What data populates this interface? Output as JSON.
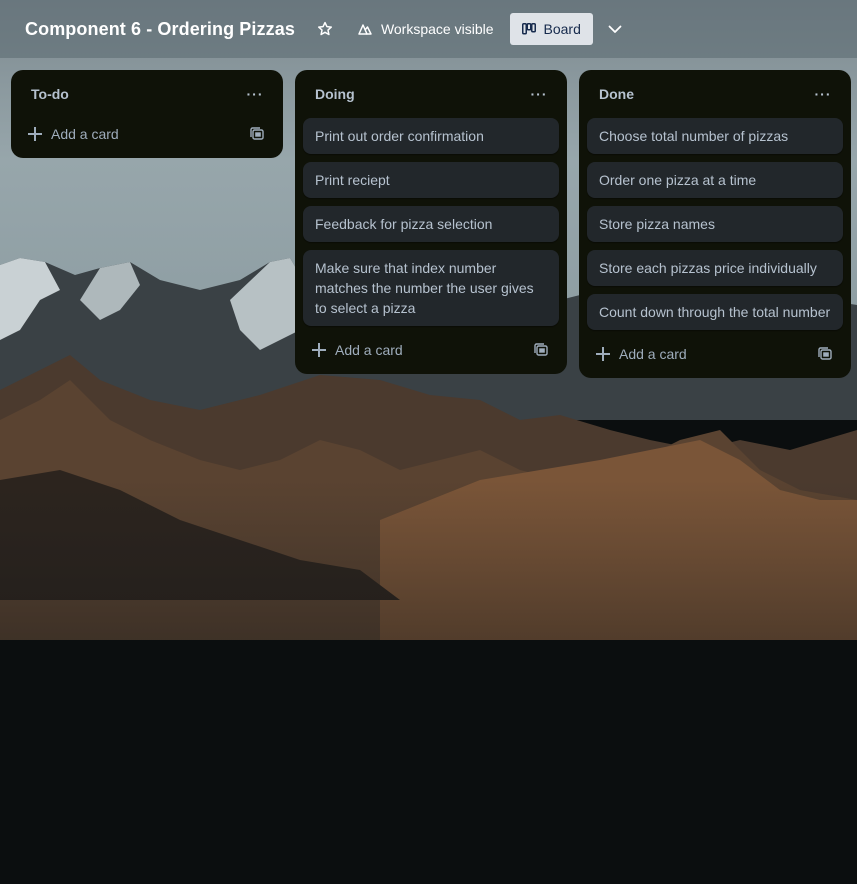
{
  "header": {
    "board_title": "Component 6 - Ordering Pizzas",
    "star_icon": "star-icon",
    "visibility_label": "Workspace visible",
    "visibility_icon": "people-icon",
    "view_label": "Board",
    "view_icon": "board-icon",
    "chevron_icon": "chevron-down-icon"
  },
  "lists": [
    {
      "title": "To-do",
      "menu_glyph": "···",
      "cards": [],
      "add_card_label": "Add a card"
    },
    {
      "title": "Doing",
      "menu_glyph": "···",
      "cards": [
        "Print out order confirmation",
        "Print reciept",
        "Feedback for pizza selection",
        "Make sure that index number matches the number the user gives to select a pizza"
      ],
      "add_card_label": "Add a card"
    },
    {
      "title": "Done",
      "menu_glyph": "···",
      "cards": [
        "Choose total number of pizzas",
        "Order one pizza at a time",
        "Store pizza names",
        "Store each pizzas price individually",
        "Count down through the total number"
      ],
      "add_card_label": "Add a card"
    }
  ],
  "colors": {
    "list_bg": "#0f1208",
    "card_bg": "#22272b",
    "text": "#b6c2cf",
    "header_bg": "#5a6870"
  }
}
